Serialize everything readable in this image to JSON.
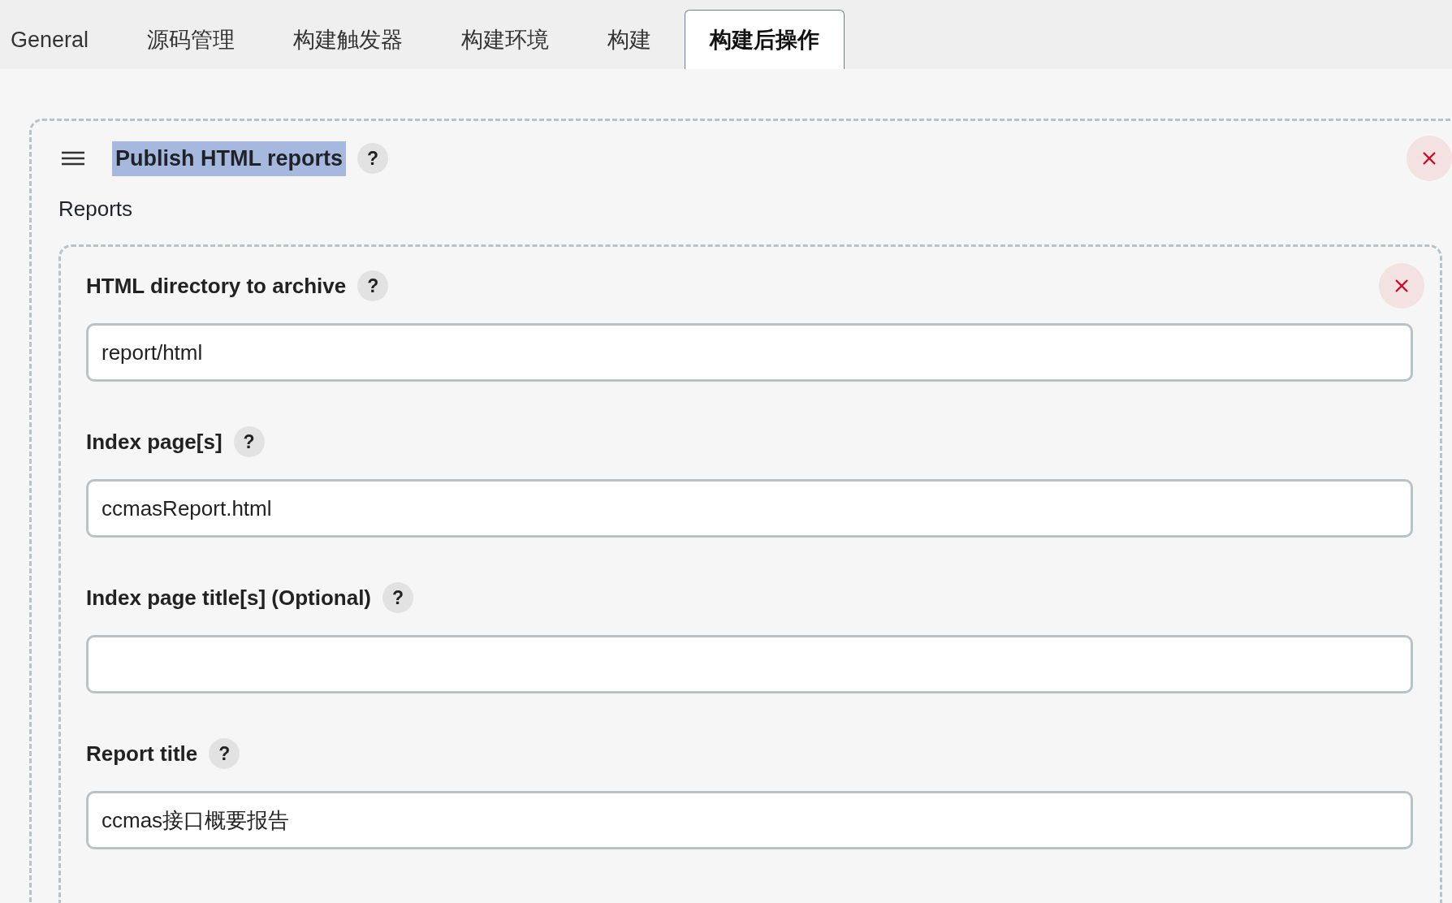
{
  "tabs": [
    {
      "label": "General",
      "selected": false
    },
    {
      "label": "源码管理",
      "selected": false
    },
    {
      "label": "构建触发器",
      "selected": false
    },
    {
      "label": "构建环境",
      "selected": false
    },
    {
      "label": "构建",
      "selected": false
    },
    {
      "label": "构建后操作",
      "selected": true
    }
  ],
  "step": {
    "title": "Publish HTML reports",
    "highlighted": true,
    "help": "?",
    "section_label": "Reports",
    "report": {
      "fields": [
        {
          "label": "HTML directory to archive",
          "help": "?",
          "value": "report/html"
        },
        {
          "label": "Index page[s]",
          "help": "?",
          "value": "ccmasReport.html"
        },
        {
          "label": "Index page title[s] (Optional)",
          "help": "?"
        },
        {
          "label": "Report title",
          "help": "?",
          "value": "ccmas接口概要报告"
        }
      ]
    }
  }
}
